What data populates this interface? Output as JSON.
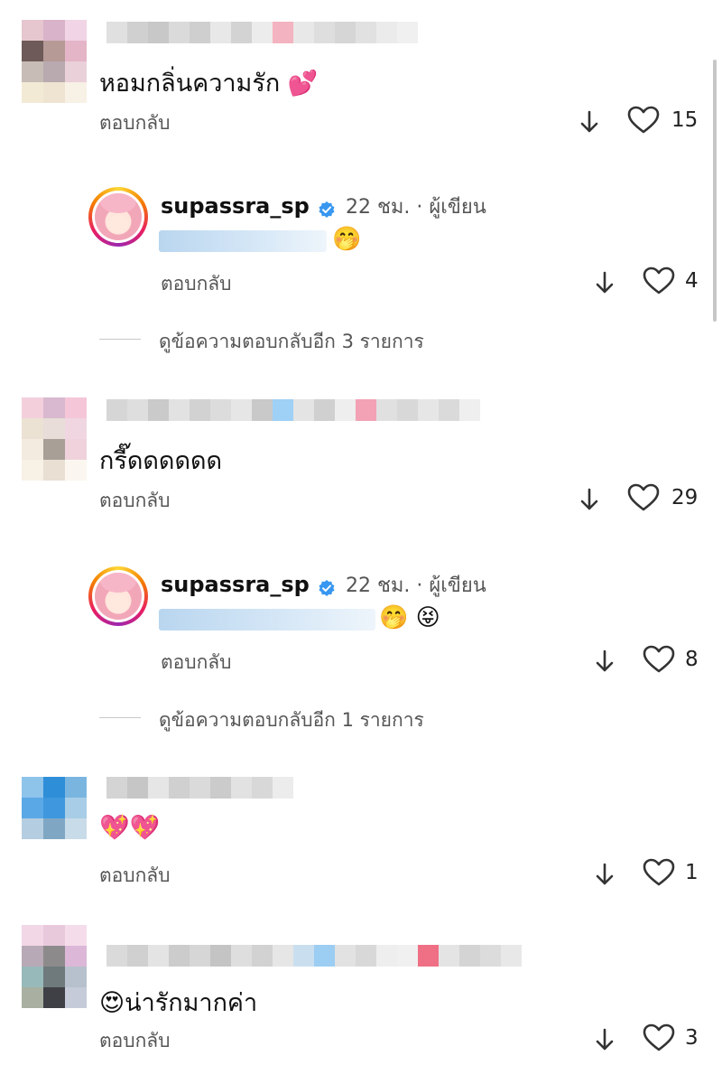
{
  "comments": [
    {
      "text": "หอมกลิ่นความรัก 💕",
      "reply_label": "ตอบกลับ",
      "likes": "15",
      "reply": {
        "username": "supassra_sp",
        "meta": "22 ชม. · ผู้เขียน",
        "emoji": "🤭",
        "reply_label": "ตอบกลับ",
        "likes": "4"
      },
      "more_replies": "ดูข้อความตอบกลับอีก 3 รายการ"
    },
    {
      "text": "กรี๊ดดดดดด",
      "reply_label": "ตอบกลับ",
      "likes": "29",
      "reply": {
        "username": "supassra_sp",
        "meta": "22 ชม. · ผู้เขียน",
        "emoji": "🤭 😝",
        "reply_label": "ตอบกลับ",
        "likes": "8"
      },
      "more_replies": "ดูข้อความตอบกลับอีก 1 รายการ"
    },
    {
      "text": "💖💖",
      "reply_label": "ตอบกลับ",
      "likes": "1"
    },
    {
      "text": "😍น่ารักมากค่า",
      "reply_label": "ตอบกลับ",
      "likes": "3"
    }
  ],
  "icons": {
    "sort": "arrow-down-icon",
    "like": "heart-outline-icon",
    "verified": "verified-badge-icon"
  },
  "colors": {
    "verified": "#3897f0",
    "text": "#111111",
    "secondary": "#555555"
  }
}
